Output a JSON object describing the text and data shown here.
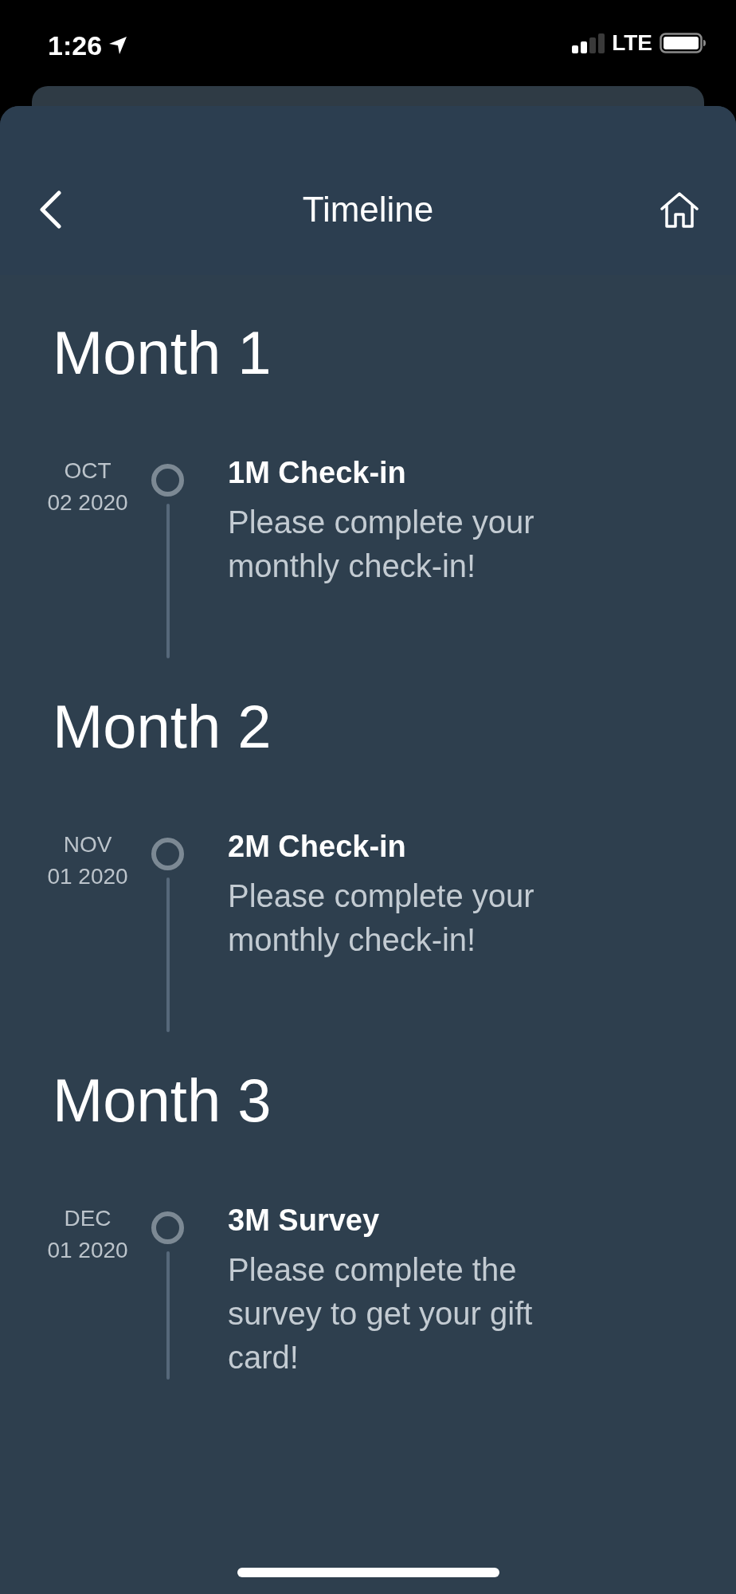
{
  "status_bar": {
    "time": "1:26",
    "network": "LTE"
  },
  "header": {
    "title": "Timeline"
  },
  "sections": [
    {
      "heading": "Month 1",
      "events": [
        {
          "month": "OCT",
          "date": "02 2020",
          "title": "1M Check-in",
          "description": "Please complete your monthly check-in!"
        }
      ]
    },
    {
      "heading": "Month 2",
      "events": [
        {
          "month": "NOV",
          "date": "01 2020",
          "title": "2M Check-in",
          "description": "Please complete your monthly check-in!"
        }
      ]
    },
    {
      "heading": "Month 3",
      "events": [
        {
          "month": "DEC",
          "date": "01 2020",
          "title": "3M Survey",
          "description": "Please complete the survey to get your gift card!"
        }
      ]
    }
  ]
}
